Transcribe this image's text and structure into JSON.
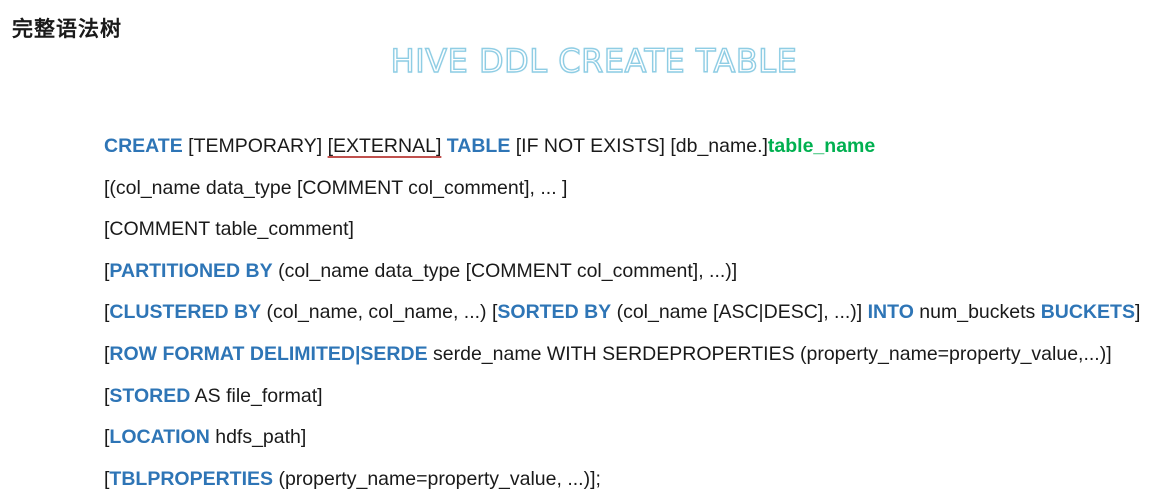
{
  "page": {
    "heading": "完整语法树",
    "slide_title": "HIVE DDL CREATE TABLE"
  },
  "colors": {
    "keyword": "#2e75b6",
    "table_name": "#00b050",
    "underline": "#c0504d",
    "title_outline": "#8fcde4",
    "text": "#1a1a1a"
  },
  "syntax": {
    "line1": {
      "kw_create": "CREATE",
      "temporary": " [TEMPORARY] ",
      "external": "[EXTERNAL]",
      "space": " ",
      "kw_table": "TABLE",
      "rest": " [IF NOT EXISTS] [db_name.]",
      "table_name": "table_name"
    },
    "line2": {
      "text": "[(col_name data_type [COMMENT col_comment], ... ]"
    },
    "line3": {
      "text": "[COMMENT table_comment]"
    },
    "line4": {
      "open": "[",
      "kw_partitioned": "PARTITIONED BY",
      "rest": " (col_name data_type [COMMENT col_comment], ...)]"
    },
    "line5": {
      "open": "[",
      "kw_clustered": "CLUSTERED BY",
      "mid1": " (col_name, col_name, ...) [",
      "kw_sorted": "SORTED BY",
      "mid2": " (col_name [ASC|DESC], ...)] ",
      "kw_into": "INTO",
      "mid3": " num_buckets ",
      "kw_buckets": "BUCKETS",
      "close": "]"
    },
    "line6": {
      "open": "[",
      "kw_row_format": "ROW FORMAT DELIMITED|SERDE",
      "rest": " serde_name WITH SERDEPROPERTIES (property_name=property_value,...)]"
    },
    "line7": {
      "open": "[",
      "kw_stored": "STORED",
      "rest": " AS file_format]"
    },
    "line8": {
      "open": "[",
      "kw_location": "LOCATION",
      "rest": " hdfs_path]"
    },
    "line9": {
      "open": "[",
      "kw_tblproperties": "TBLPROPERTIES",
      "rest": " (property_name=property_value, ...)];"
    }
  }
}
